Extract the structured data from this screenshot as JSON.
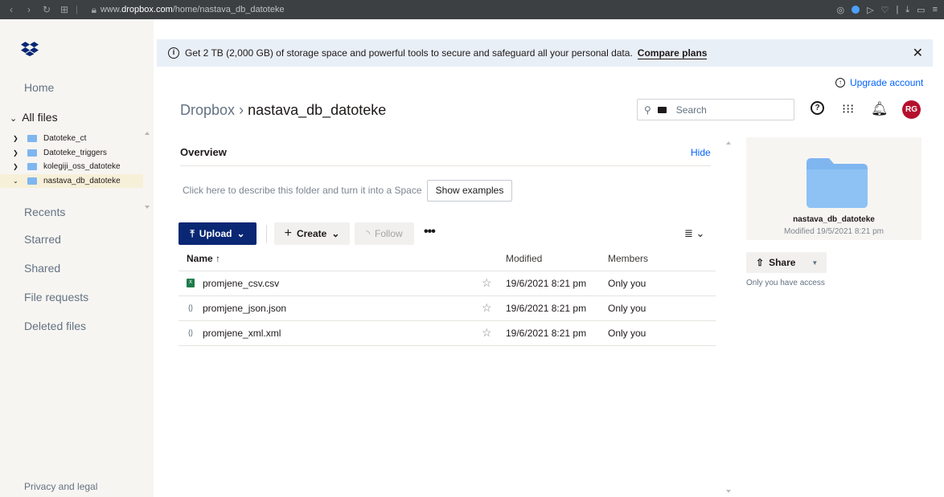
{
  "browser": {
    "url_prefix": "www.",
    "url_domain": "dropbox.com",
    "url_path": "/home/nastava_db_datoteke"
  },
  "sidebar": {
    "home": "Home",
    "all_files": "All files",
    "tree": [
      {
        "label": "Datoteke_ct",
        "expanded": false,
        "selected": false
      },
      {
        "label": "Datoteke_triggers",
        "expanded": false,
        "selected": false
      },
      {
        "label": "kolegiji_oss_datoteke",
        "expanded": false,
        "selected": false
      },
      {
        "label": "nastava_db_datoteke",
        "expanded": true,
        "selected": true
      }
    ],
    "recents": "Recents",
    "starred": "Starred",
    "shared": "Shared",
    "file_requests": "File requests",
    "deleted_files": "Deleted files",
    "privacy": "Privacy and legal"
  },
  "banner": {
    "text": "Get 2 TB (2,000 GB) of storage space and powerful tools to secure and safeguard all your personal data.",
    "cta": "Compare plans"
  },
  "header": {
    "upgrade": "Upgrade account",
    "breadcrumb_root": "Dropbox",
    "breadcrumb_sep": "›",
    "breadcrumb_current": "nastava_db_datoteke",
    "search_placeholder": "Search",
    "avatar_initials": "RG"
  },
  "overview": {
    "title": "Overview",
    "hide": "Hide",
    "describe": "Click here to describe this folder and turn it into a Space",
    "show_examples": "Show examples"
  },
  "toolbar": {
    "upload": "Upload",
    "create": "Create",
    "follow": "Follow"
  },
  "table": {
    "col_name": "Name",
    "col_modified": "Modified",
    "col_members": "Members",
    "rows": [
      {
        "name": "promjene_csv.csv",
        "modified": "19/6/2021 8:21 pm",
        "members": "Only you",
        "icon": "csv-icon"
      },
      {
        "name": "promjene_json.json",
        "modified": "19/6/2021 8:21 pm",
        "members": "Only you",
        "icon": "code-file-icon"
      },
      {
        "name": "promjene_xml.xml",
        "modified": "19/6/2021 8:21 pm",
        "members": "Only you",
        "icon": "code-file-icon"
      }
    ]
  },
  "details": {
    "folder_name": "nastava_db_datoteke",
    "modified": "Modified 19/5/2021 8:21 pm",
    "share": "Share",
    "access": "Only you have access"
  },
  "colors": {
    "brand_blue": "#0061fe",
    "upload_navy": "#0a2774",
    "avatar_red": "#b5102d",
    "folder_blue": "#7fb6f0"
  }
}
